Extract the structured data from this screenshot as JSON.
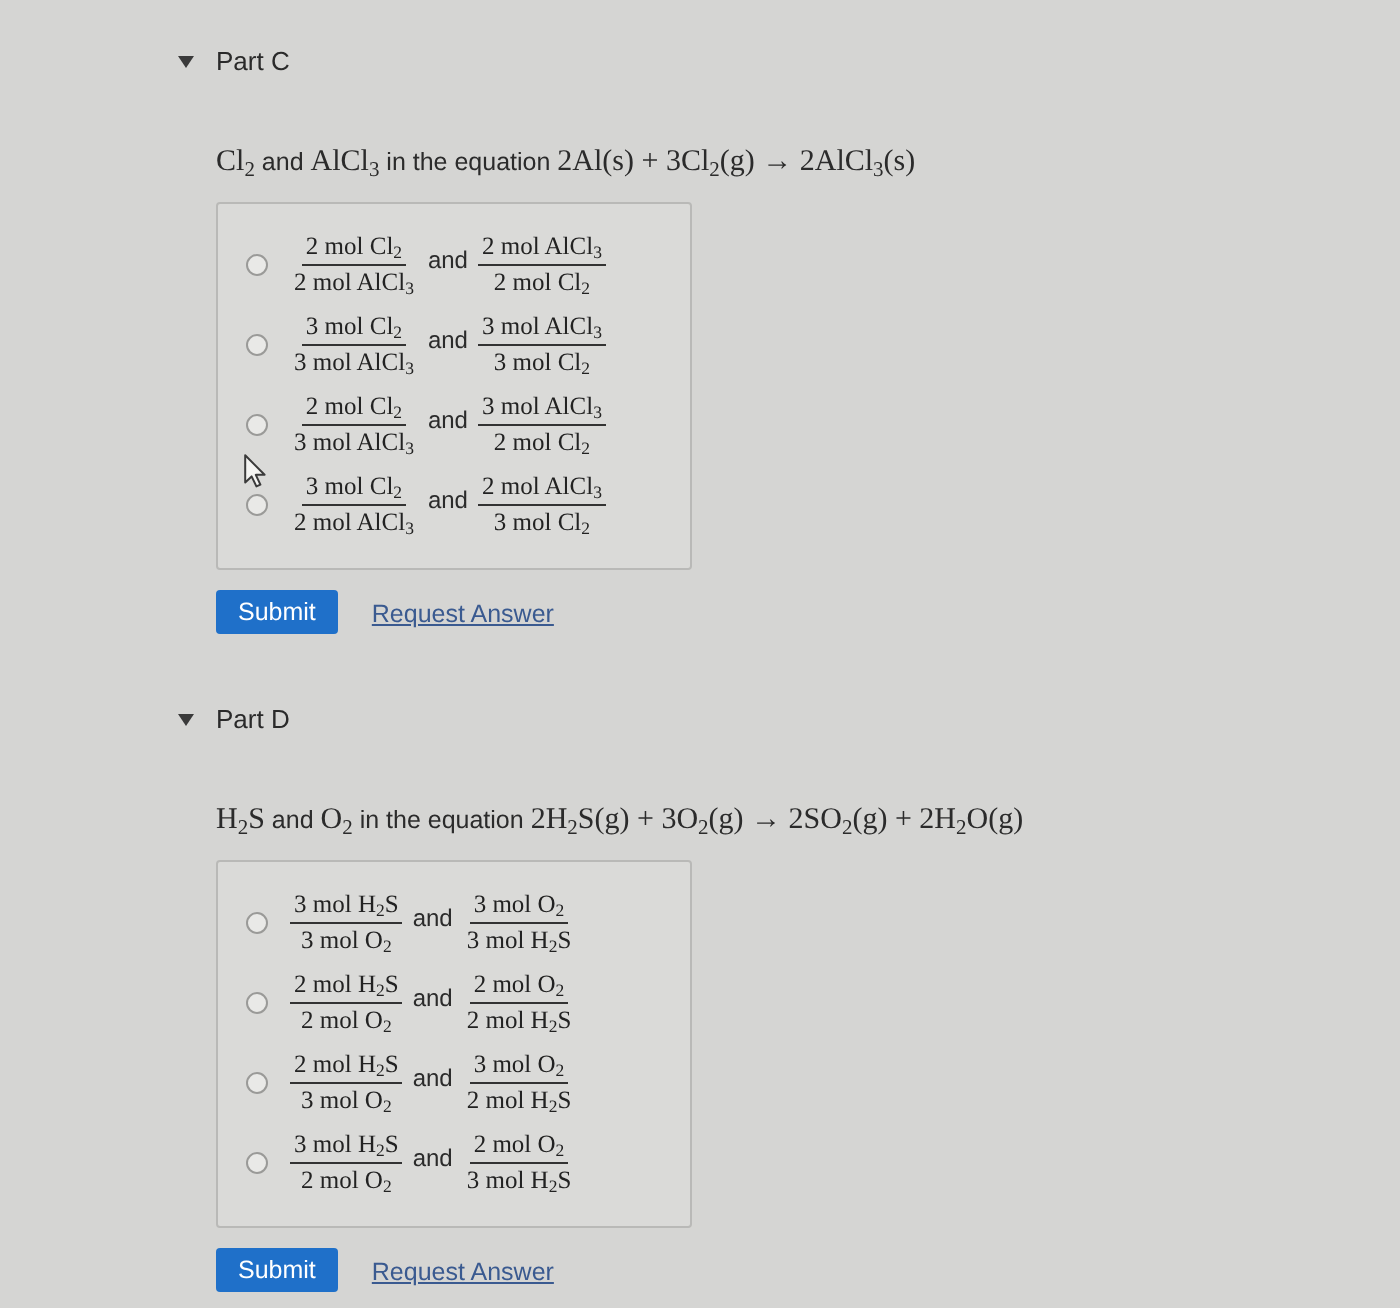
{
  "parts": [
    {
      "title": "Part C",
      "expanded": true,
      "cursor": true,
      "question": [
        {
          "kind": "formula",
          "text": "Cl$_{2}$"
        },
        {
          "kind": "text",
          "text": " and "
        },
        {
          "kind": "formula",
          "text": "AlCl$_{3}$"
        },
        {
          "kind": "text",
          "text": " in the equation "
        },
        {
          "kind": "formula",
          "text": "2Al(s) + 3Cl$_{2}$(g) → 2AlCl$_{3}$(s)"
        }
      ],
      "options": [
        {
          "selected": false,
          "joiner": "and",
          "fractions": [
            {
              "numerator": "2 mol Cl$_{2}$",
              "denominator": "2 mol AlCl$_{3}$"
            },
            {
              "numerator": "2 mol AlCl$_{3}$",
              "denominator": "2 mol Cl$_{2}$"
            }
          ]
        },
        {
          "selected": false,
          "joiner": "and",
          "fractions": [
            {
              "numerator": "3 mol Cl$_{2}$",
              "denominator": "3 mol AlCl$_{3}$"
            },
            {
              "numerator": "3 mol AlCl$_{3}$",
              "denominator": "3 mol Cl$_{2}$"
            }
          ]
        },
        {
          "selected": false,
          "joiner": "and",
          "fractions": [
            {
              "numerator": "2 mol Cl$_{2}$",
              "denominator": "3 mol AlCl$_{3}$"
            },
            {
              "numerator": "3 mol AlCl$_{3}$",
              "denominator": "2 mol Cl$_{2}$"
            }
          ]
        },
        {
          "selected": false,
          "joiner": "and",
          "fractions": [
            {
              "numerator": "3 mol Cl$_{2}$",
              "denominator": "2 mol AlCl$_{3}$"
            },
            {
              "numerator": "2 mol AlCl$_{3}$",
              "denominator": "3 mol Cl$_{2}$"
            }
          ]
        }
      ],
      "submit": "Submit",
      "request": "Request Answer"
    },
    {
      "title": "Part D",
      "expanded": true,
      "question": [
        {
          "kind": "formula",
          "text": "H$_{2}$S"
        },
        {
          "kind": "text",
          "text": " and "
        },
        {
          "kind": "formula",
          "text": "O$_{2}$"
        },
        {
          "kind": "text",
          "text": " in the equation "
        },
        {
          "kind": "formula",
          "text": "2H$_{2}$S(g) + 3O$_{2}$(g) → 2SO$_{2}$(g) + 2H$_{2}$O(g)"
        }
      ],
      "options": [
        {
          "selected": false,
          "joiner": "and",
          "fractions": [
            {
              "numerator": "3 mol H$_{2}$S",
              "denominator": "3 mol O$_{2}$"
            },
            {
              "numerator": "3 mol O$_{2}$",
              "denominator": "3 mol H$_{2}$S"
            }
          ]
        },
        {
          "selected": false,
          "joiner": "and",
          "fractions": [
            {
              "numerator": "2 mol H$_{2}$S",
              "denominator": "2 mol O$_{2}$"
            },
            {
              "numerator": "2 mol O$_{2}$",
              "denominator": "2 mol H$_{2}$S"
            }
          ]
        },
        {
          "selected": false,
          "joiner": "and",
          "fractions": [
            {
              "numerator": "2 mol H$_{2}$S",
              "denominator": "3 mol O$_{2}$"
            },
            {
              "numerator": "3 mol O$_{2}$",
              "denominator": "2 mol H$_{2}$S"
            }
          ]
        },
        {
          "selected": false,
          "joiner": "and",
          "fractions": [
            {
              "numerator": "3 mol H$_{2}$S",
              "denominator": "2 mol O$_{2}$"
            },
            {
              "numerator": "2 mol O$_{2}$",
              "denominator": "3 mol H$_{2}$S"
            }
          ]
        }
      ],
      "submit": "Submit",
      "request": "Request Answer"
    }
  ]
}
